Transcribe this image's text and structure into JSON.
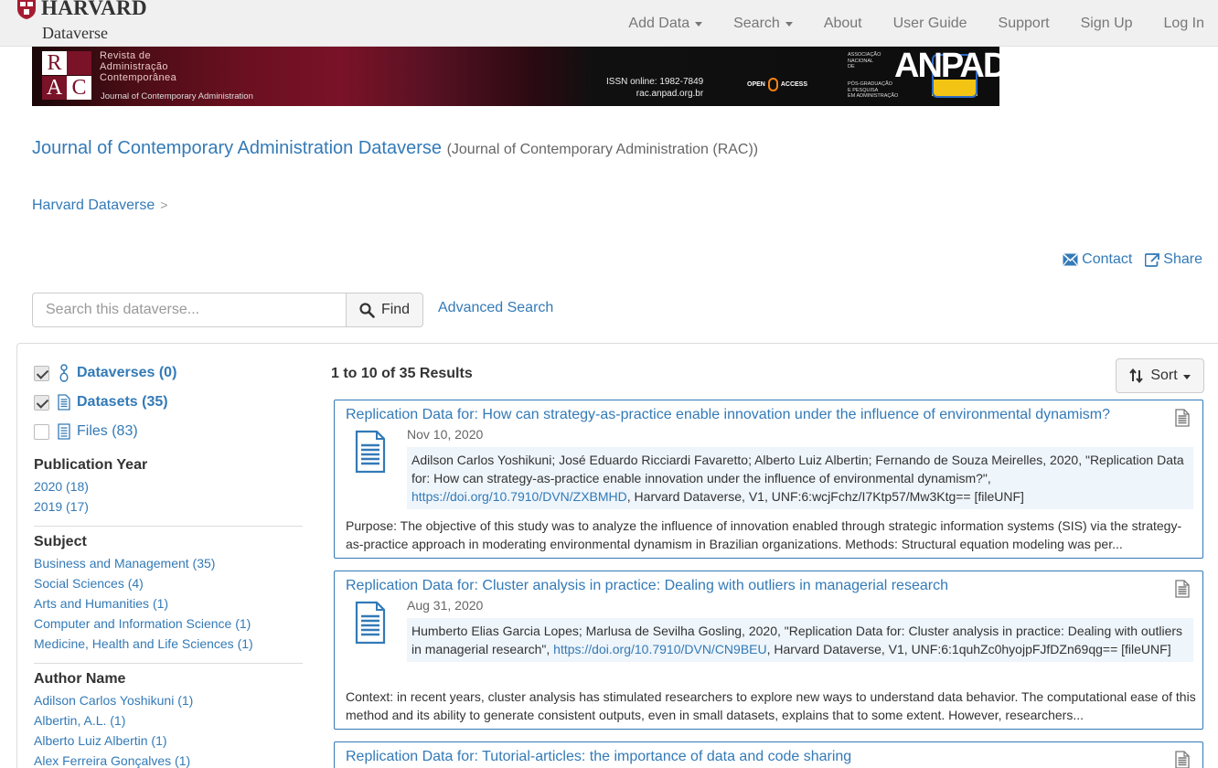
{
  "nav": {
    "brand_name": "HARVARD",
    "brand_sub": "Dataverse",
    "items": [
      {
        "label": "Add Data",
        "dropdown": true
      },
      {
        "label": "Search",
        "dropdown": true
      },
      {
        "label": "About",
        "dropdown": false
      },
      {
        "label": "User Guide",
        "dropdown": false
      },
      {
        "label": "Support",
        "dropdown": false
      },
      {
        "label": "Sign Up",
        "dropdown": false
      },
      {
        "label": "Log In",
        "dropdown": false
      }
    ]
  },
  "banner": {
    "rac_letters": [
      "R",
      "A",
      "C"
    ],
    "line1": "Revista de",
    "line2": "Administração",
    "line3": "Contemporânea",
    "line4": "Journal of Contemporary Administration",
    "issn": "ISSN online: 1982-7849",
    "url": "rac.anpad.org.br",
    "open": "OPEN",
    "access": "ACCESS",
    "assoc_top": "ASSOCIAÇÃO\nNACIONAL\nDE",
    "anpad": "ANPAD",
    "assoc_bottom": "PÓS-GRADUAÇÃO\nE PESQUISA\nEM ADMINISTRAÇÃO"
  },
  "header": {
    "title": "Journal of Contemporary Administration Dataverse",
    "affiliation": "(Journal of Contemporary Administration (RAC))",
    "breadcrumb": "Harvard Dataverse",
    "breadcrumb_sep": ">",
    "contact": "Contact",
    "share": "Share"
  },
  "search": {
    "placeholder": "Search this dataverse...",
    "find_label": "Find",
    "advanced_label": "Advanced Search"
  },
  "facets": {
    "toggles": [
      {
        "label": "Dataverses (0)",
        "checked": true,
        "icon": "dataverse-icon"
      },
      {
        "label": "Datasets (35)",
        "checked": true,
        "icon": "dataset-icon"
      },
      {
        "label": "Files (83)",
        "checked": false,
        "icon": "file-icon"
      }
    ],
    "pub_year": {
      "heading": "Publication Year",
      "items": [
        "2020 (18)",
        "2019 (17)"
      ]
    },
    "subject": {
      "heading": "Subject",
      "items": [
        "Business and Management (35)",
        "Social Sciences (4)",
        "Arts and Humanities (1)",
        "Computer and Information Science (1)",
        "Medicine, Health and Life Sciences (1)"
      ]
    },
    "author": {
      "heading": "Author Name",
      "items": [
        "Adilson Carlos Yoshikuni (1)",
        "Albertin, A.L. (1)",
        "Alberto Luiz Albertin (1)",
        "Alex Ferreira Gonçalves (1)"
      ]
    }
  },
  "results": {
    "count_text": "1 to 10 of 35 Results",
    "sort_label": "Sort",
    "items": [
      {
        "title": "Replication Data for: How can strategy-as-practice enable innovation under the influence of environmental dynamism?",
        "date": "Nov 10, 2020",
        "cite_pre": "Adilson Carlos Yoshikuni; José Eduardo Ricciardi Favaretto; Alberto Luiz Albertin; Fernando de Souza Meirelles, 2020, \"Replication Data for: How can strategy-as-practice enable innovation under the influence of environmental dynamism?\", ",
        "doi": "https://doi.org/10.7910/DVN/ZXBMHD",
        "cite_post": ", Harvard Dataverse, V1, UNF:6:wcjFchz/I7Ktp57/Mw3Ktg== [fileUNF]",
        "desc": "Purpose: The objective of this study was to analyze the influence of innovation enabled through strategic information systems (SIS) via the strategy-as-practice approach in moderating environmental dynamism in Brazilian organizations. Methods: Structural equation modeling was per..."
      },
      {
        "title": "Replication Data for: Cluster analysis in practice: Dealing with outliers in managerial research",
        "date": "Aug 31, 2020",
        "cite_pre": "Humberto Elias Garcia Lopes; Marlusa de Sevilha Gosling, 2020, \"Replication Data for: Cluster analysis in practice: Dealing with outliers in managerial research\", ",
        "doi": "https://doi.org/10.7910/DVN/CN9BEU",
        "cite_post": ", Harvard Dataverse, V1, UNF:6:1quhZc0hyojpFJfDZn69qg== [fileUNF]",
        "desc": "Context: in recent years, cluster analysis has stimulated researchers to explore new ways to understand data behavior. The computational ease of this method and its ability to generate consistent outputs, even in small datasets, explains that to some extent. However, researchers..."
      },
      {
        "title": "Replication Data for: Tutorial-articles: the importance of data and code sharing"
      }
    ]
  },
  "colors": {
    "link": "#337ab7",
    "navbar_bg": "#f0f0f0",
    "cite_bg": "#eef5fb",
    "harvard_crimson": "#a51c30"
  }
}
